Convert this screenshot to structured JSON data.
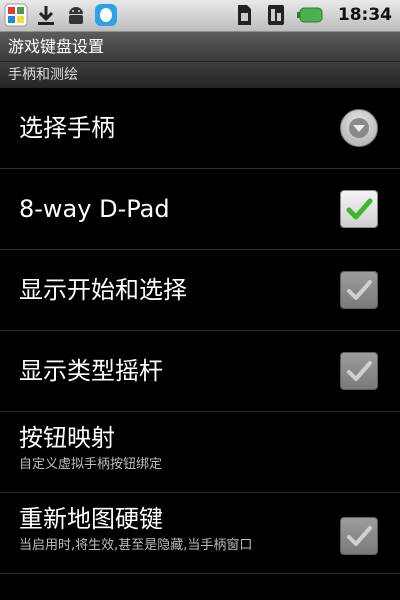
{
  "status_bar": {
    "left_icons": [
      "app-store-icon",
      "download-icon",
      "android-icon",
      "qq-icon"
    ],
    "right_icons": [
      "sim-card-icon",
      "phone-signal-icon",
      "battery-icon"
    ],
    "time": "18:34"
  },
  "title_bar": {
    "title": "游戏键盘设置"
  },
  "category": {
    "label": "手柄和测绘"
  },
  "preferences": [
    {
      "title": "选择手柄",
      "widget": "dropdown"
    },
    {
      "title": "8-way D-Pad",
      "widget": "checkbox",
      "checked": true,
      "enabled": true
    },
    {
      "title": "显示开始和选择",
      "widget": "checkbox",
      "checked": true,
      "enabled": false
    },
    {
      "title": "显示类型摇杆",
      "widget": "checkbox",
      "checked": true,
      "enabled": false
    },
    {
      "title": "按钮映射",
      "summary": "自定义虚拟手柄按钮绑定",
      "widget": "none"
    },
    {
      "title": "重新地图硬键",
      "summary": "当启用时,将生效,甚至是隐藏,当手柄窗口",
      "widget": "checkbox",
      "checked": true,
      "enabled": false
    }
  ],
  "colors": {
    "check_green": "#3cb82a",
    "check_disabled": "#d0d0d0"
  }
}
